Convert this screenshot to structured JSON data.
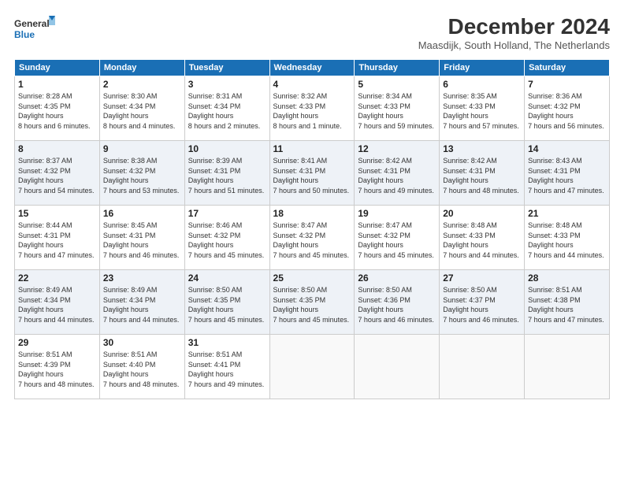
{
  "header": {
    "logo_line1": "General",
    "logo_line2": "Blue",
    "title": "December 2024",
    "location": "Maasdijk, South Holland, The Netherlands"
  },
  "days_of_week": [
    "Sunday",
    "Monday",
    "Tuesday",
    "Wednesday",
    "Thursday",
    "Friday",
    "Saturday"
  ],
  "weeks": [
    [
      {
        "day": "1",
        "sunrise": "8:28 AM",
        "sunset": "4:35 PM",
        "daylight": "8 hours and 6 minutes."
      },
      {
        "day": "2",
        "sunrise": "8:30 AM",
        "sunset": "4:34 PM",
        "daylight": "8 hours and 4 minutes."
      },
      {
        "day": "3",
        "sunrise": "8:31 AM",
        "sunset": "4:34 PM",
        "daylight": "8 hours and 2 minutes."
      },
      {
        "day": "4",
        "sunrise": "8:32 AM",
        "sunset": "4:33 PM",
        "daylight": "8 hours and 1 minute."
      },
      {
        "day": "5",
        "sunrise": "8:34 AM",
        "sunset": "4:33 PM",
        "daylight": "7 hours and 59 minutes."
      },
      {
        "day": "6",
        "sunrise": "8:35 AM",
        "sunset": "4:33 PM",
        "daylight": "7 hours and 57 minutes."
      },
      {
        "day": "7",
        "sunrise": "8:36 AM",
        "sunset": "4:32 PM",
        "daylight": "7 hours and 56 minutes."
      }
    ],
    [
      {
        "day": "8",
        "sunrise": "8:37 AM",
        "sunset": "4:32 PM",
        "daylight": "7 hours and 54 minutes."
      },
      {
        "day": "9",
        "sunrise": "8:38 AM",
        "sunset": "4:32 PM",
        "daylight": "7 hours and 53 minutes."
      },
      {
        "day": "10",
        "sunrise": "8:39 AM",
        "sunset": "4:31 PM",
        "daylight": "7 hours and 51 minutes."
      },
      {
        "day": "11",
        "sunrise": "8:41 AM",
        "sunset": "4:31 PM",
        "daylight": "7 hours and 50 minutes."
      },
      {
        "day": "12",
        "sunrise": "8:42 AM",
        "sunset": "4:31 PM",
        "daylight": "7 hours and 49 minutes."
      },
      {
        "day": "13",
        "sunrise": "8:42 AM",
        "sunset": "4:31 PM",
        "daylight": "7 hours and 48 minutes."
      },
      {
        "day": "14",
        "sunrise": "8:43 AM",
        "sunset": "4:31 PM",
        "daylight": "7 hours and 47 minutes."
      }
    ],
    [
      {
        "day": "15",
        "sunrise": "8:44 AM",
        "sunset": "4:31 PM",
        "daylight": "7 hours and 47 minutes."
      },
      {
        "day": "16",
        "sunrise": "8:45 AM",
        "sunset": "4:31 PM",
        "daylight": "7 hours and 46 minutes."
      },
      {
        "day": "17",
        "sunrise": "8:46 AM",
        "sunset": "4:32 PM",
        "daylight": "7 hours and 45 minutes."
      },
      {
        "day": "18",
        "sunrise": "8:47 AM",
        "sunset": "4:32 PM",
        "daylight": "7 hours and 45 minutes."
      },
      {
        "day": "19",
        "sunrise": "8:47 AM",
        "sunset": "4:32 PM",
        "daylight": "7 hours and 45 minutes."
      },
      {
        "day": "20",
        "sunrise": "8:48 AM",
        "sunset": "4:33 PM",
        "daylight": "7 hours and 44 minutes."
      },
      {
        "day": "21",
        "sunrise": "8:48 AM",
        "sunset": "4:33 PM",
        "daylight": "7 hours and 44 minutes."
      }
    ],
    [
      {
        "day": "22",
        "sunrise": "8:49 AM",
        "sunset": "4:34 PM",
        "daylight": "7 hours and 44 minutes."
      },
      {
        "day": "23",
        "sunrise": "8:49 AM",
        "sunset": "4:34 PM",
        "daylight": "7 hours and 44 minutes."
      },
      {
        "day": "24",
        "sunrise": "8:50 AM",
        "sunset": "4:35 PM",
        "daylight": "7 hours and 45 minutes."
      },
      {
        "day": "25",
        "sunrise": "8:50 AM",
        "sunset": "4:35 PM",
        "daylight": "7 hours and 45 minutes."
      },
      {
        "day": "26",
        "sunrise": "8:50 AM",
        "sunset": "4:36 PM",
        "daylight": "7 hours and 46 minutes."
      },
      {
        "day": "27",
        "sunrise": "8:50 AM",
        "sunset": "4:37 PM",
        "daylight": "7 hours and 46 minutes."
      },
      {
        "day": "28",
        "sunrise": "8:51 AM",
        "sunset": "4:38 PM",
        "daylight": "7 hours and 47 minutes."
      }
    ],
    [
      {
        "day": "29",
        "sunrise": "8:51 AM",
        "sunset": "4:39 PM",
        "daylight": "7 hours and 48 minutes."
      },
      {
        "day": "30",
        "sunrise": "8:51 AM",
        "sunset": "4:40 PM",
        "daylight": "7 hours and 48 minutes."
      },
      {
        "day": "31",
        "sunrise": "8:51 AM",
        "sunset": "4:41 PM",
        "daylight": "7 hours and 49 minutes."
      },
      null,
      null,
      null,
      null
    ]
  ],
  "labels": {
    "sunrise": "Sunrise:",
    "sunset": "Sunset:",
    "daylight": "Daylight hours"
  }
}
